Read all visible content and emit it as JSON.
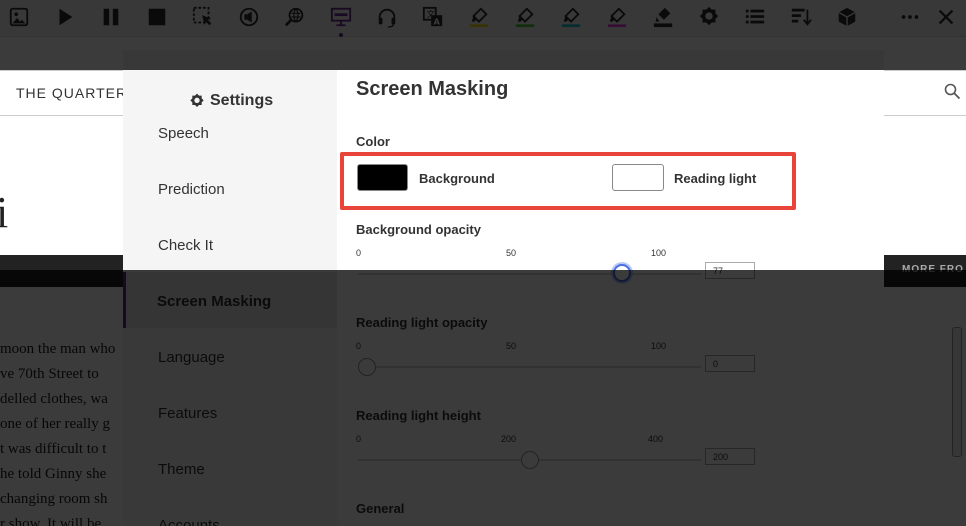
{
  "toolbar": {
    "buttons": [
      {
        "name": "picture-icon"
      },
      {
        "name": "play-icon"
      },
      {
        "name": "pause-icon"
      },
      {
        "name": "stop-icon"
      },
      {
        "name": "select-tool-icon"
      },
      {
        "name": "read-aloud-icon"
      },
      {
        "name": "web-search-icon"
      },
      {
        "name": "screen-masking-icon"
      },
      {
        "name": "headset-icon"
      },
      {
        "name": "translate-icon"
      },
      {
        "name": "highlighter-yellow-icon"
      },
      {
        "name": "highlighter-green-icon"
      },
      {
        "name": "highlighter-cyan-icon"
      },
      {
        "name": "highlighter-magenta-icon"
      },
      {
        "name": "clear-highlights-icon"
      },
      {
        "name": "settings-gear-icon"
      },
      {
        "name": "list-icon"
      },
      {
        "name": "sort-icon"
      },
      {
        "name": "cube-icon"
      },
      {
        "name": "more-icon"
      },
      {
        "name": "close-icon"
      }
    ],
    "highlight_colors": {
      "yellow": "#f4d81a",
      "green": "#4fc636",
      "cyan": "#19c3c8",
      "magenta": "#e03ad8"
    },
    "active_color": "#6b2a8f"
  },
  "article": {
    "nav_title": "THE QUARTER",
    "big_letter": "i",
    "bar_right": "MORE FRO",
    "lines": [
      "moon the man who",
      "ve 70th Street to",
      "delled clothes, wa",
      "one of her really g",
      "t was difficult to t",
      "he told Ginny she",
      "changing room sh",
      "r show. It will be"
    ]
  },
  "settings": {
    "title": "Settings",
    "menu": [
      "Speech",
      "Prediction",
      "Check It",
      "Screen Masking",
      "Language",
      "Features",
      "Theme",
      "Accounts"
    ],
    "selected": "Screen Masking",
    "accent": "#5a2b8a"
  },
  "screen_masking": {
    "title": "Screen Masking",
    "color_label": "Color",
    "background_label": "Background",
    "background_color": "#000000",
    "reading_light_label": "Reading light",
    "reading_light_color": "#ffffff",
    "highlight_color": "#e9443a",
    "background_opacity": {
      "label": "Background opacity",
      "ticks": [
        "0",
        "50",
        "100"
      ],
      "value": 77,
      "value_text": "77"
    },
    "reading_light_opacity": {
      "label": "Reading light opacity",
      "ticks": [
        "0",
        "50",
        "100"
      ],
      "value": 0,
      "value_text": "0"
    },
    "reading_light_height": {
      "label": "Reading light height",
      "ticks": [
        "0",
        "200",
        "400"
      ],
      "value": 200,
      "value_text": "200"
    },
    "general_label": "General"
  }
}
